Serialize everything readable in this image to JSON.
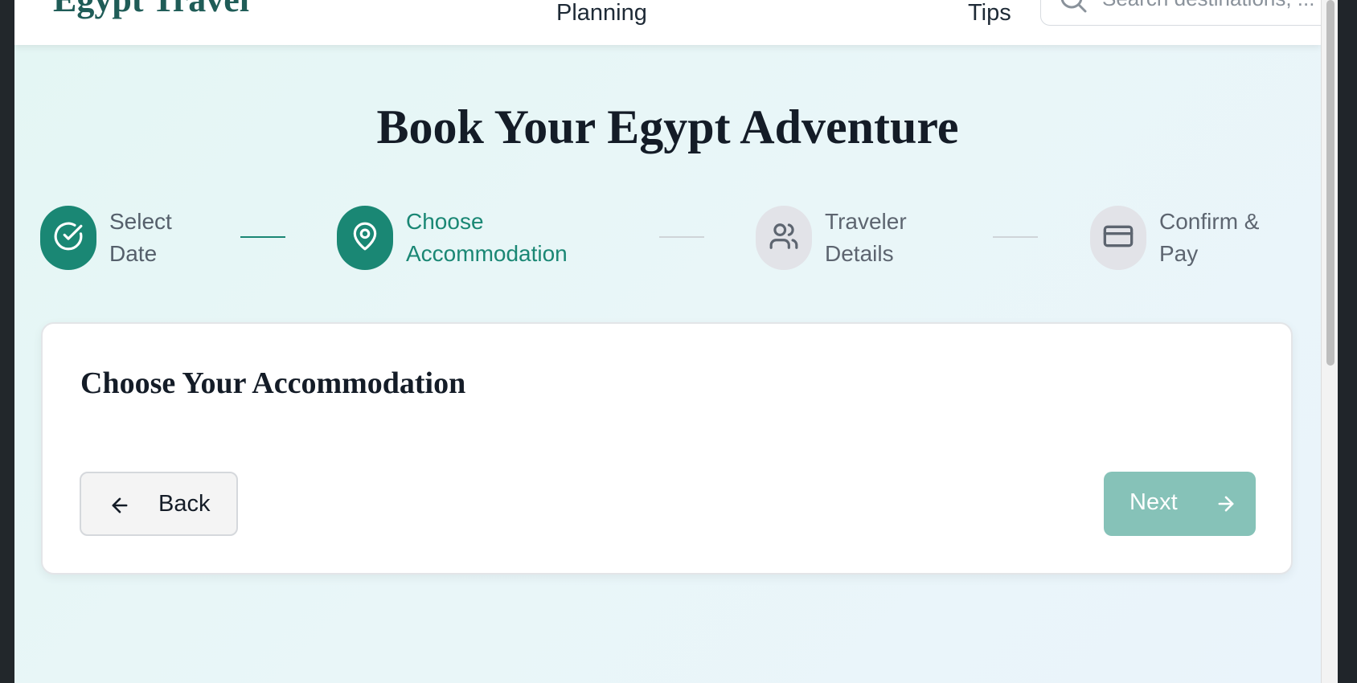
{
  "header": {
    "brand": "Egypt Travel",
    "nav": [
      {
        "label": "Planning"
      },
      {
        "label": "Tips"
      }
    ],
    "search": {
      "placeholder": "Search destinations, ..."
    }
  },
  "page": {
    "title": "Book Your Egypt Adventure"
  },
  "stepper": {
    "steps": [
      {
        "label": "Select\nDate",
        "state": "completed",
        "icon": "check-circle-icon"
      },
      {
        "label": "Choose\nAccommodation",
        "state": "current",
        "icon": "map-pin-icon"
      },
      {
        "label": "Traveler\nDetails",
        "state": "upcoming",
        "icon": "users-icon"
      },
      {
        "label": "Confirm &\nPay",
        "state": "upcoming",
        "icon": "credit-card-icon"
      }
    ]
  },
  "card": {
    "title": "Choose Your Accommodation",
    "back_label": "Back",
    "next_label": "Next"
  },
  "colors": {
    "accent": "#1a8774",
    "accent_disabled": "#86c2b8",
    "brand": "#1f5c57",
    "inactive_step": "#e2e3e8"
  }
}
